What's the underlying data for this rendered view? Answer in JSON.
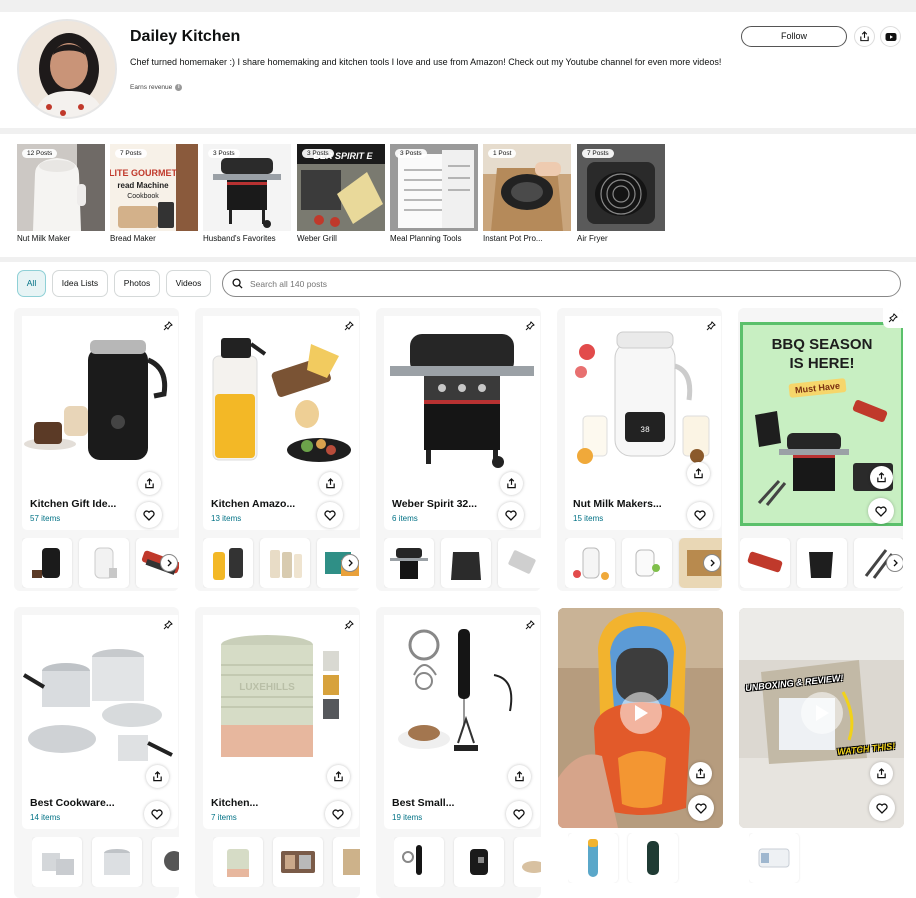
{
  "profile": {
    "name": "Dailey Kitchen",
    "bio": "Chef turned homemaker :) I share homemaking and kitchen tools I love and use from Amazon! Check out my Youtube channel for even more videos!",
    "earns_revenue": "Earns revenue",
    "follow_label": "Follow",
    "info_glyph": "i"
  },
  "idea_lists": [
    {
      "label": "Nut Milk Maker",
      "posts": "12 Posts"
    },
    {
      "label": "Bread Maker",
      "posts": "7 Posts"
    },
    {
      "label": "Husband's Favorites",
      "posts": "3 Posts"
    },
    {
      "label": "Weber Grill",
      "posts": "3 Posts"
    },
    {
      "label": "Meal Planning Tools",
      "posts": "3 Posts"
    },
    {
      "label": "Instant Pot Pro...",
      "posts": "1 Post"
    },
    {
      "label": "Air Fryer",
      "posts": "7 Posts"
    }
  ],
  "tile_text": {
    "bread_line1": "LITE GOURMET",
    "bread_line2": "read Machine",
    "bread_line3": "Cookbook",
    "weber_banner": "BER SPIRIT E"
  },
  "filters": {
    "all": "All",
    "idea_lists": "Idea Lists",
    "photos": "Photos",
    "videos": "Videos",
    "search_placeholder": "Search all 140 posts"
  },
  "cards": [
    {
      "title": "Kitchen Gift Ide...",
      "count": "57 items"
    },
    {
      "title": "Kitchen Amazo...",
      "count": "13 items"
    },
    {
      "title": "Weber Spirit 32...",
      "count": "6 items"
    },
    {
      "title": "Nut Milk Makers...",
      "count": "15 items"
    },
    {
      "title": "Best Cookware...",
      "count": "14 items"
    },
    {
      "title": "Kitchen...",
      "count": "7 items"
    },
    {
      "title": "Best Small...",
      "count": "19 items"
    }
  ],
  "bbq_post": {
    "line1": "BBQ SEASON",
    "line2": "IS HERE!",
    "badge": "Must Have"
  },
  "video_post": {
    "overlay_top": "UNBOXING & REVIEW!",
    "overlay_bottom": "WATCH THIS!"
  },
  "colors": {
    "accent_teal": "#007185",
    "active_chip_bg": "#e7f4f5",
    "bbq_green": "#c8efc2",
    "bbq_border": "#5bc06b"
  }
}
